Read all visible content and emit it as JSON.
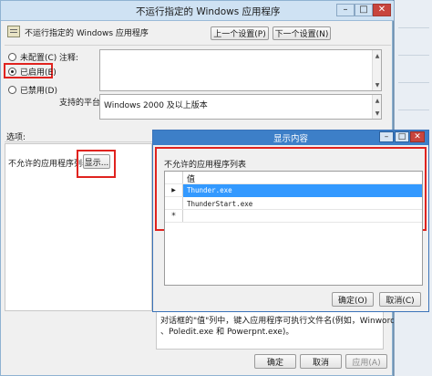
{
  "main_window": {
    "title": "不运行指定的 Windows 应用程序",
    "header_title": "不运行指定的 Windows 应用程序",
    "prev_setting_label": "上一个设置(P)",
    "next_setting_label": "下一个设置(N)",
    "radio_not_configured": "未配置(C)",
    "radio_enabled": "已启用(E)",
    "radio_disabled": "已禁用(D)",
    "comment_label": "注释:",
    "supported_on_label": "支持的平台:",
    "supported_on_value": "Windows 2000 及以上版本",
    "options_label": "选项:",
    "disallowed_apps_label": "不允许的应用程序列表",
    "show_button_label": "显示...",
    "help_line1": "对话框的\"值\"列中，键入应用程序可执行文件名(例如，Winword.exe",
    "help_line2": "、Poledit.exe 和 Powerpnt.exe)。",
    "ok_label": "确定",
    "cancel_label": "取消",
    "apply_label": "应用(A)"
  },
  "dialog": {
    "title": "显示内容",
    "list_label": "不允许的应用程序列表",
    "column_header": "值",
    "rows": [
      "Thunder.exe",
      "ThunderStart.exe"
    ],
    "new_row_marker": "*",
    "current_row_marker": "▶",
    "ok_label": "确定(O)",
    "cancel_label": "取消(C)"
  },
  "icons": {
    "minimize": "minimize-icon",
    "maximize": "maximize-icon",
    "close": "close-icon",
    "policy": "policy-icon"
  },
  "colors": {
    "highlight_red": "#e0231f",
    "selection_blue": "#3399ff",
    "dialog_title_blue": "#3d7fc8"
  }
}
